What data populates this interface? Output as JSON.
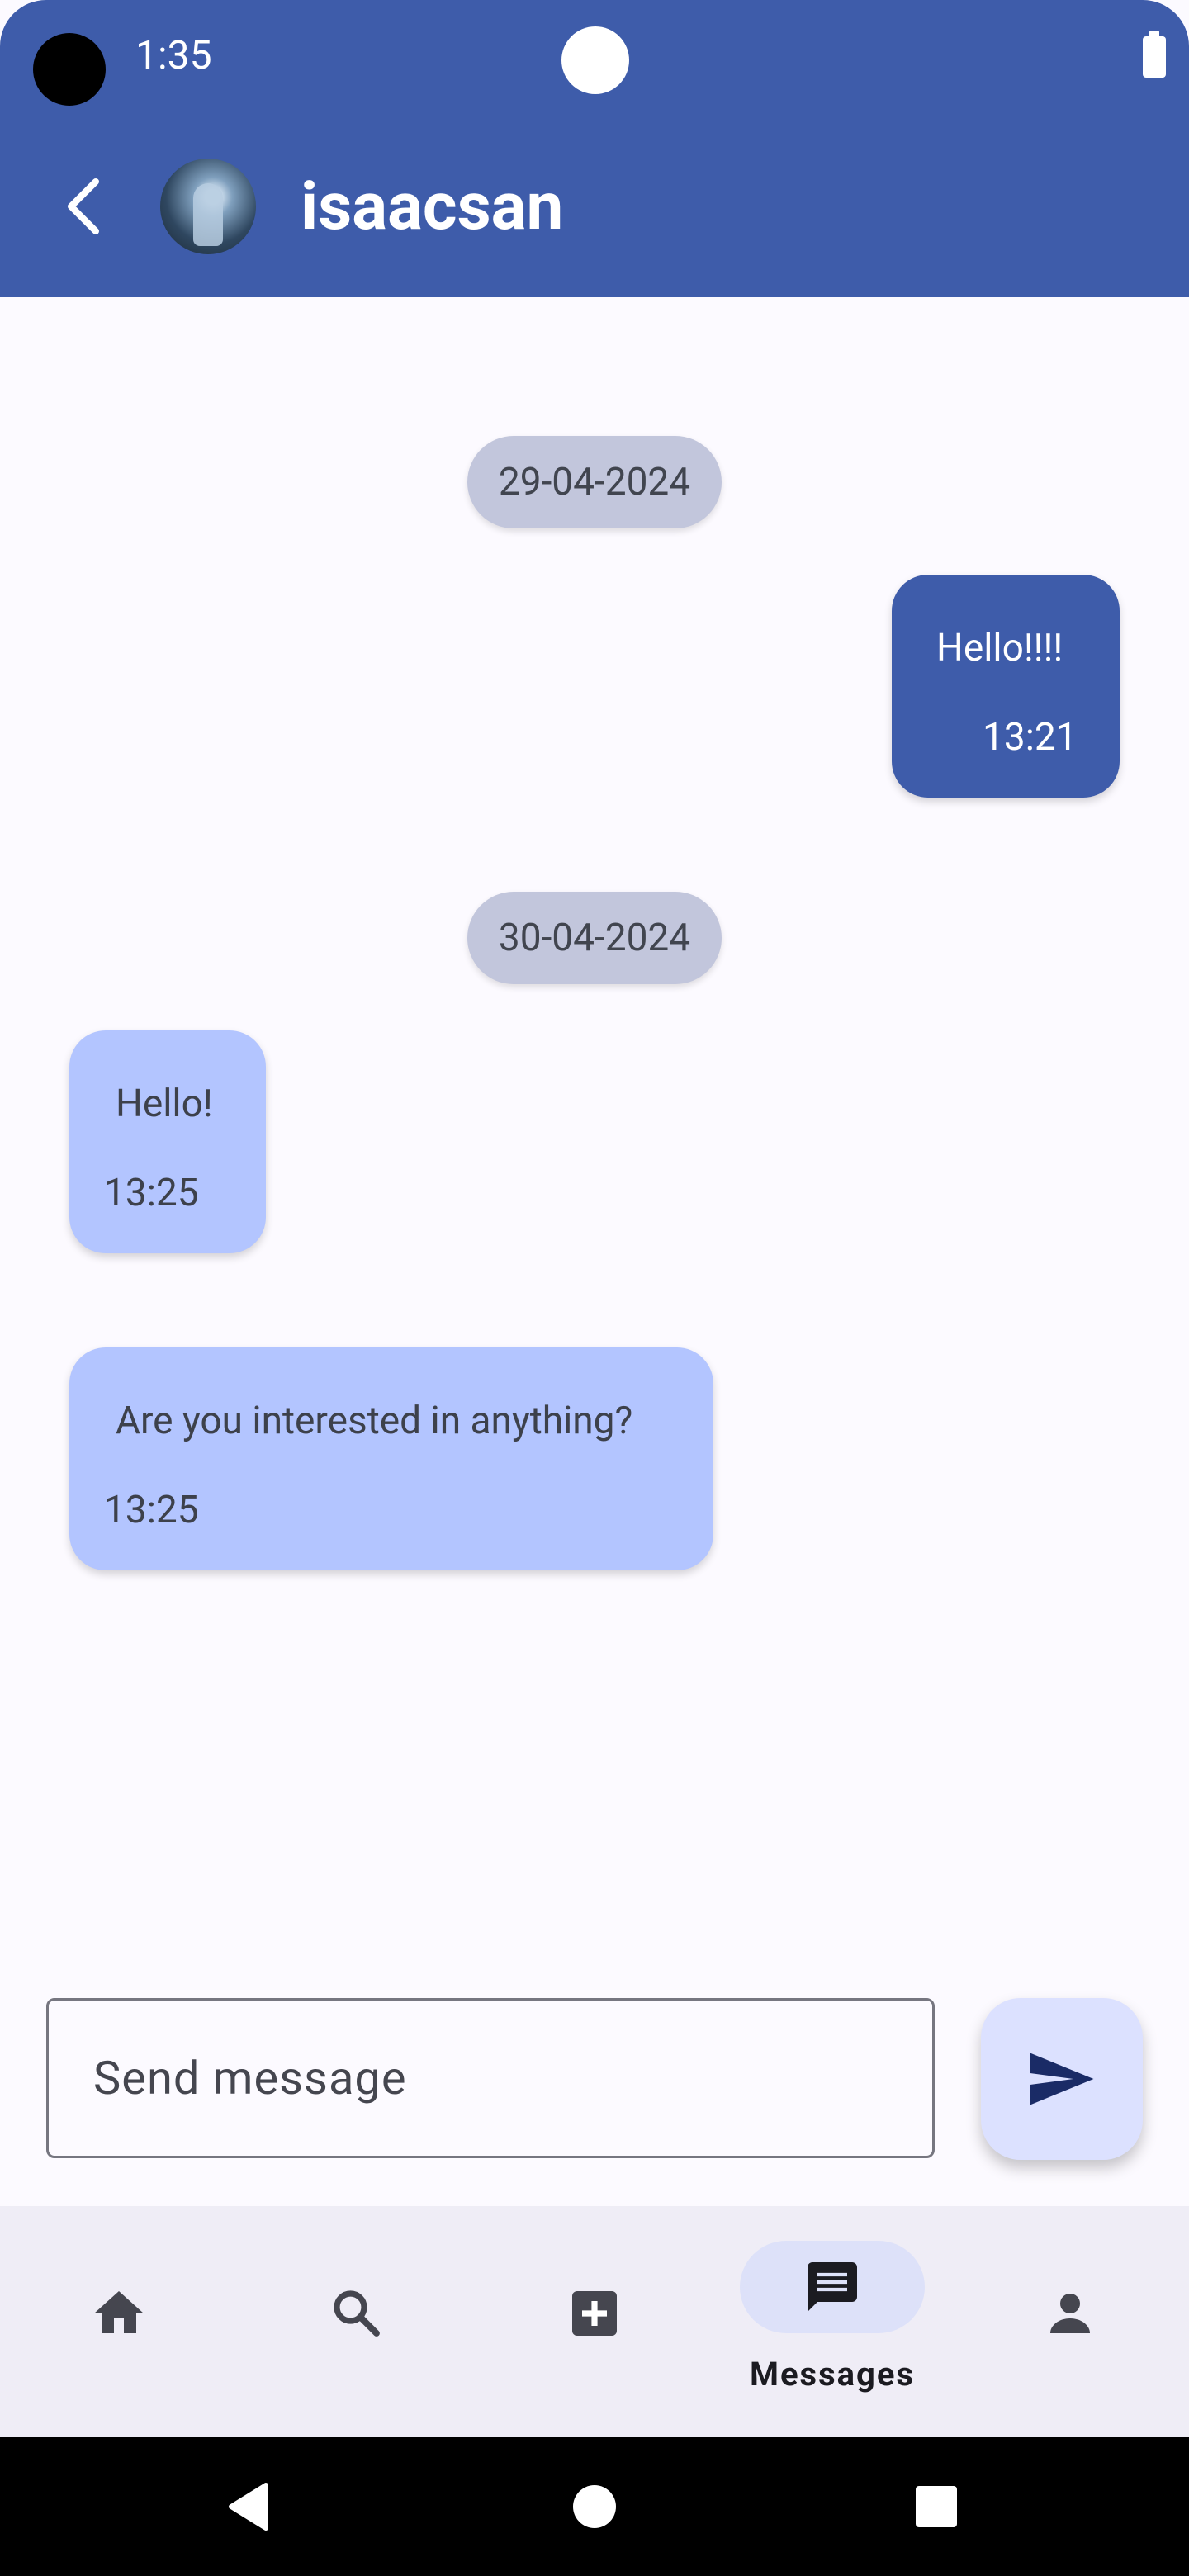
{
  "status_bar": {
    "time": "1:35"
  },
  "header": {
    "title": "isaacsan",
    "back_icon": "chevron-left-icon"
  },
  "chat": {
    "date_1": "29-04-2024",
    "msg_1": {
      "text": "Hello!!!!",
      "time": "13:21"
    },
    "date_2": "30-04-2024",
    "msg_2": {
      "text": "Hello!",
      "time": "13:25"
    },
    "msg_3": {
      "text": "Are you interested in anything?",
      "time": "13:25"
    }
  },
  "composer": {
    "placeholder": "Send message",
    "value": ""
  },
  "bottom_nav": {
    "items": [
      {
        "icon": "home-icon"
      },
      {
        "icon": "search-icon"
      },
      {
        "icon": "add-box-icon"
      },
      {
        "icon": "message-icon",
        "label": "Messages",
        "selected": true
      },
      {
        "icon": "person-icon"
      }
    ]
  },
  "colors": {
    "primary": "#3e5caa",
    "received_bubble": "#b3c5ff",
    "date_pill": "#c2c6dc",
    "background": "#fcfaff",
    "send_button": "#dce1ff"
  }
}
